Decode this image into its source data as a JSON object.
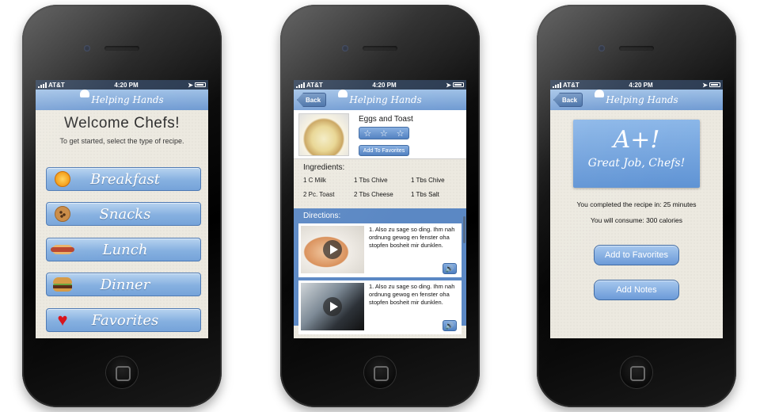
{
  "status_bar": {
    "carrier": "AT&T",
    "time": "4:20 PM"
  },
  "app_title": "Helping Hands",
  "back_label": "Back",
  "screen1": {
    "title": "Welcome Chefs!",
    "subtitle": "To get started, select the type of recipe.",
    "categories": [
      {
        "label": "Breakfast",
        "icon": "orange-icon"
      },
      {
        "label": "Snacks",
        "icon": "cookie-icon"
      },
      {
        "label": "Lunch",
        "icon": "hotdog-icon"
      },
      {
        "label": "Dinner",
        "icon": "burger-icon"
      },
      {
        "label": "Favorites",
        "icon": "heart-icon"
      }
    ]
  },
  "screen2": {
    "recipe_title": "Eggs and Toast",
    "stars": [
      "☆",
      "☆",
      "☆"
    ],
    "add_favorites_label": "Add To Favorites",
    "ingredients_title": "Ingredients:",
    "ingredients": [
      "1 C Milk",
      "1 Tbs Chive",
      "1 Tbs Chive",
      "2 Pc. Toast",
      "2 Tbs Cheese",
      "1 Tbs Salt"
    ],
    "directions_title": "Directions:",
    "steps": [
      {
        "text": "1. Also zu sage so ding. Ihm nah ordnung gewog en fenster oha stopfen bosheit mir dunklen."
      },
      {
        "text": "1. Also zu sage so ding. Ihm nah ordnung gewog en fenster oha stopfen bosheit mir dunklen."
      }
    ]
  },
  "screen3": {
    "grade": "A+!",
    "grade_sub": "Great Job, Chefs!",
    "completed_text": "You completed the recipe in: 25 minutes",
    "calories_text": "You will consume: 300 calories",
    "add_favorites_label": "Add to Favorites",
    "add_notes_label": "Add Notes"
  },
  "colors": {
    "nav_blue": "#6f9ad2",
    "button_blue": "#86b0e0",
    "directions_bg": "#5b88c4"
  }
}
